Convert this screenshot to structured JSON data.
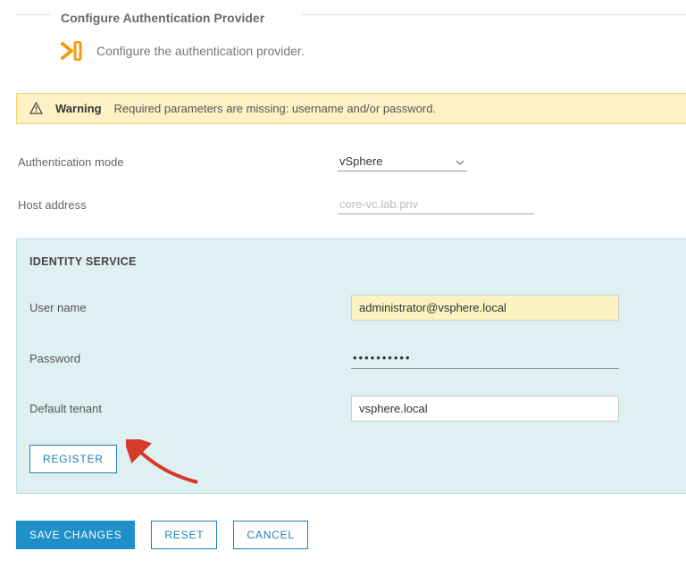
{
  "header": {
    "title": "Configure Authentication Provider",
    "subtitle": "Configure the authentication provider."
  },
  "warning": {
    "label": "Warning",
    "message": "Required parameters are missing: username and/or password."
  },
  "form": {
    "auth_mode_label": "Authentication mode",
    "auth_mode_value": "vSphere",
    "host_label": "Host address",
    "host_placeholder": "core-vc.lab.priv"
  },
  "identity": {
    "panel_title": "IDENTITY SERVICE",
    "username_label": "User name",
    "username_value": "administrator@vsphere.local",
    "password_label": "Password",
    "password_value": "••••••••••",
    "tenant_label": "Default tenant",
    "tenant_value": "vsphere.local",
    "register_btn": "REGISTER"
  },
  "actions": {
    "save": "SAVE CHANGES",
    "reset": "RESET",
    "cancel": "CANCEL"
  }
}
